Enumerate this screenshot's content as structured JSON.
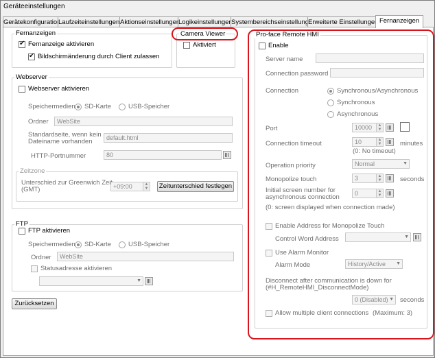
{
  "window": {
    "title": "Geräteeinstellungen"
  },
  "tabs": [
    "Gerätekonfiguration",
    "Laufzeiteinstellungen",
    "Aktionseinstellungen",
    "Logikeinstellungen",
    "Systembereichseinstellungen",
    "Erweiterte Einstellungen",
    "Fernanzeigen"
  ],
  "fernanzeigen": {
    "title": "Fernanzeigen",
    "enable_label": "Fernanzeige aktivieren",
    "allow_label": "Bildschirmänderung durch Client zulassen"
  },
  "camera": {
    "title": "Camera Viewer",
    "enable_label": "Aktiviert"
  },
  "webserver": {
    "title": "Webserver",
    "enable_label": "Webserver aktivieren",
    "speicher_label": "Speichermedien",
    "sd_label": "SD-Karte",
    "usb_label": "USB-Speicher",
    "ordner_label": "Ordner",
    "ordner_value": "WebSite",
    "standard_label_1": "Standardseite, wenn kein",
    "standard_label_2": "Dateiname vorhanden",
    "standard_value": "default.html",
    "port_label": "HTTP-Portnummer",
    "port_value": "80",
    "zeitzone_title": "Zeitzone",
    "zeit_label_1": "Unterschied zur Greenwich Zeit",
    "zeit_label_2": "(GMT)",
    "zeit_value": "+09:00",
    "zeit_button": "Zeitunterschied festlegen"
  },
  "ftp": {
    "title": "FTP",
    "enable_label": "FTP aktivieren",
    "speicher_label": "Speichermedien",
    "sd_label": "SD-Karte",
    "usb_label": "USB-Speicher",
    "ordner_label": "Ordner",
    "ordner_value": "WebSite",
    "status_label": "Statusadresse aktivieren"
  },
  "reset_button": "Zurücksetzen",
  "remote": {
    "title": "Pro-face Remote HMI",
    "enable_label": "Enable",
    "server_name_label": "Server name",
    "conn_password_label": "Connection password",
    "connection_label": "Connection",
    "opt_sync_async": "Synchronous/Asynchronous",
    "opt_sync": "Synchronous",
    "opt_async": "Asynchronous",
    "port_label": "Port",
    "port_value": "10000",
    "timeout_label": "Connection timeout",
    "timeout_value": "10",
    "timeout_unit": "minutes",
    "timeout_note": "(0: No timeout)",
    "priority_label": "Operation priority",
    "priority_value": "Normal",
    "monopolize_label": "Monopolize touch",
    "monopolize_value": "3",
    "monopolize_unit": "seconds",
    "initial_label_1": "Initial screen number for",
    "initial_label_2": "asynchronous connection",
    "initial_value": "0",
    "initial_note": "(0: screen displayed when connection made)",
    "enable_address_label": "Enable Address for Monopolize Touch",
    "control_word_label": "Control Word Address",
    "alarm_monitor_label": "Use Alarm Monitor",
    "alarm_mode_label": "Alarm Mode",
    "alarm_mode_value": "History/Active",
    "disconnect_label_1": "Disconnect after communication is down for",
    "disconnect_label_2": "(#H_RemoteHMI_DisconnectMode)",
    "disconnect_value": "0 (Disabled)",
    "disconnect_unit": "seconds",
    "multiple_label": "Allow multiple client connections",
    "multiple_note": "(Maximum: 3)"
  },
  "colors": {
    "highlight": "#d8141c"
  }
}
